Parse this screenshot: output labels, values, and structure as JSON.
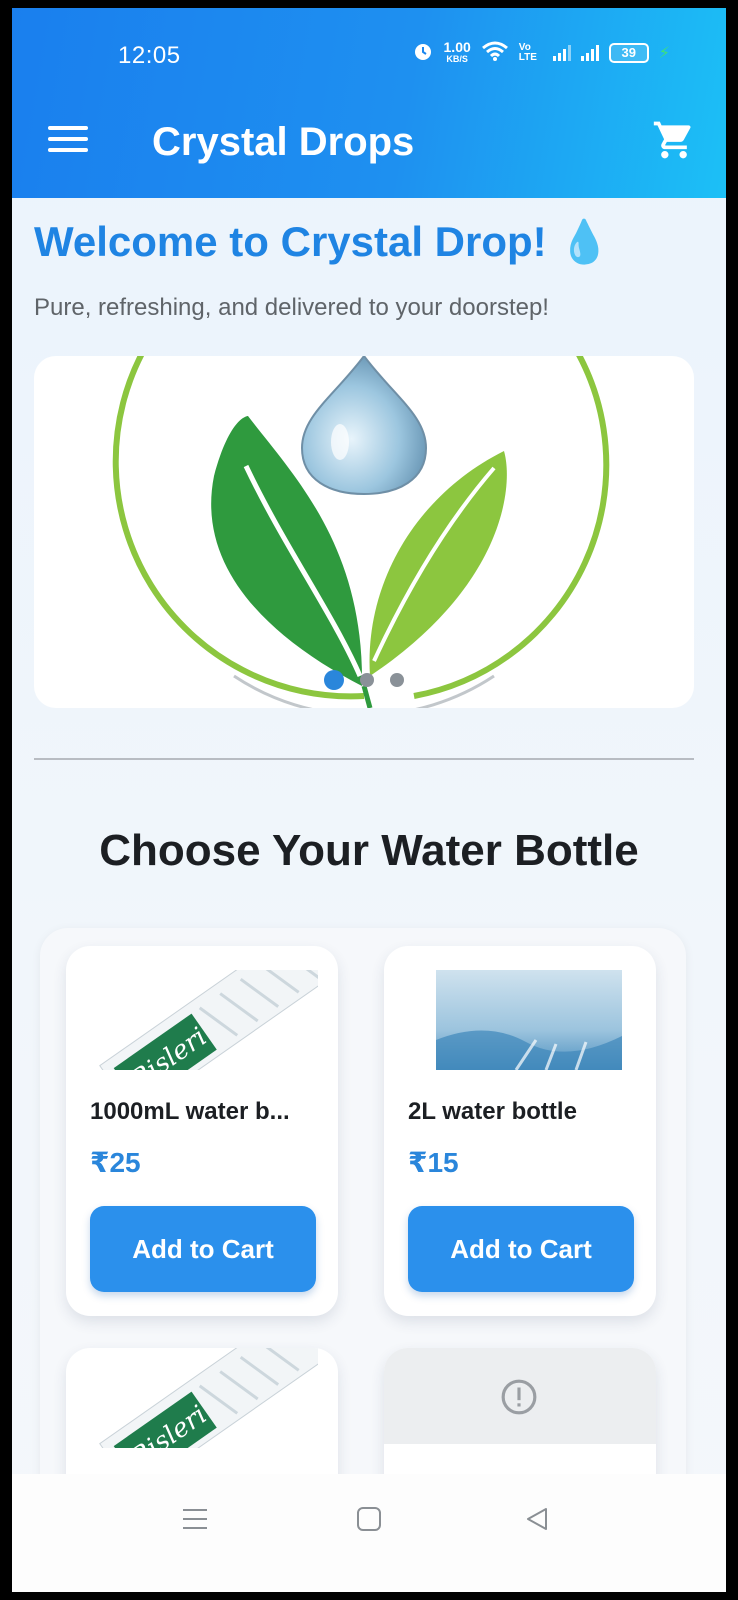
{
  "status_bar": {
    "time": "12:05",
    "speed_value": "1.00",
    "speed_unit": "KB/S",
    "volte": "Vo LTE",
    "battery": "39"
  },
  "app_bar": {
    "title": "Crystal Drops",
    "menu_icon": "hamburger-icon",
    "cart_icon": "cart-icon"
  },
  "hero": {
    "welcome": "Welcome to Crystal Drop! 💧",
    "subtitle": "Pure, refreshing, and delivered to your doorstep!"
  },
  "carousel": {
    "slides": 3,
    "active_index": 0
  },
  "section": {
    "title": "Choose Your Water Bottle"
  },
  "products": [
    {
      "name": "1000mL water b...",
      "price": "₹25",
      "button": "Add to Cart",
      "image": "bisleri-bottle"
    },
    {
      "name": "2L water bottle",
      "price": "₹15",
      "button": "Add to Cart",
      "image": "water-bottle"
    },
    {
      "image": "bisleri-bottle"
    },
    {
      "image": "error-placeholder"
    }
  ],
  "colors": {
    "primary": "#2b90ec",
    "title_blue": "#1f84e3",
    "leaf_dark": "#2f9a3e",
    "leaf_light": "#8cc63f"
  }
}
